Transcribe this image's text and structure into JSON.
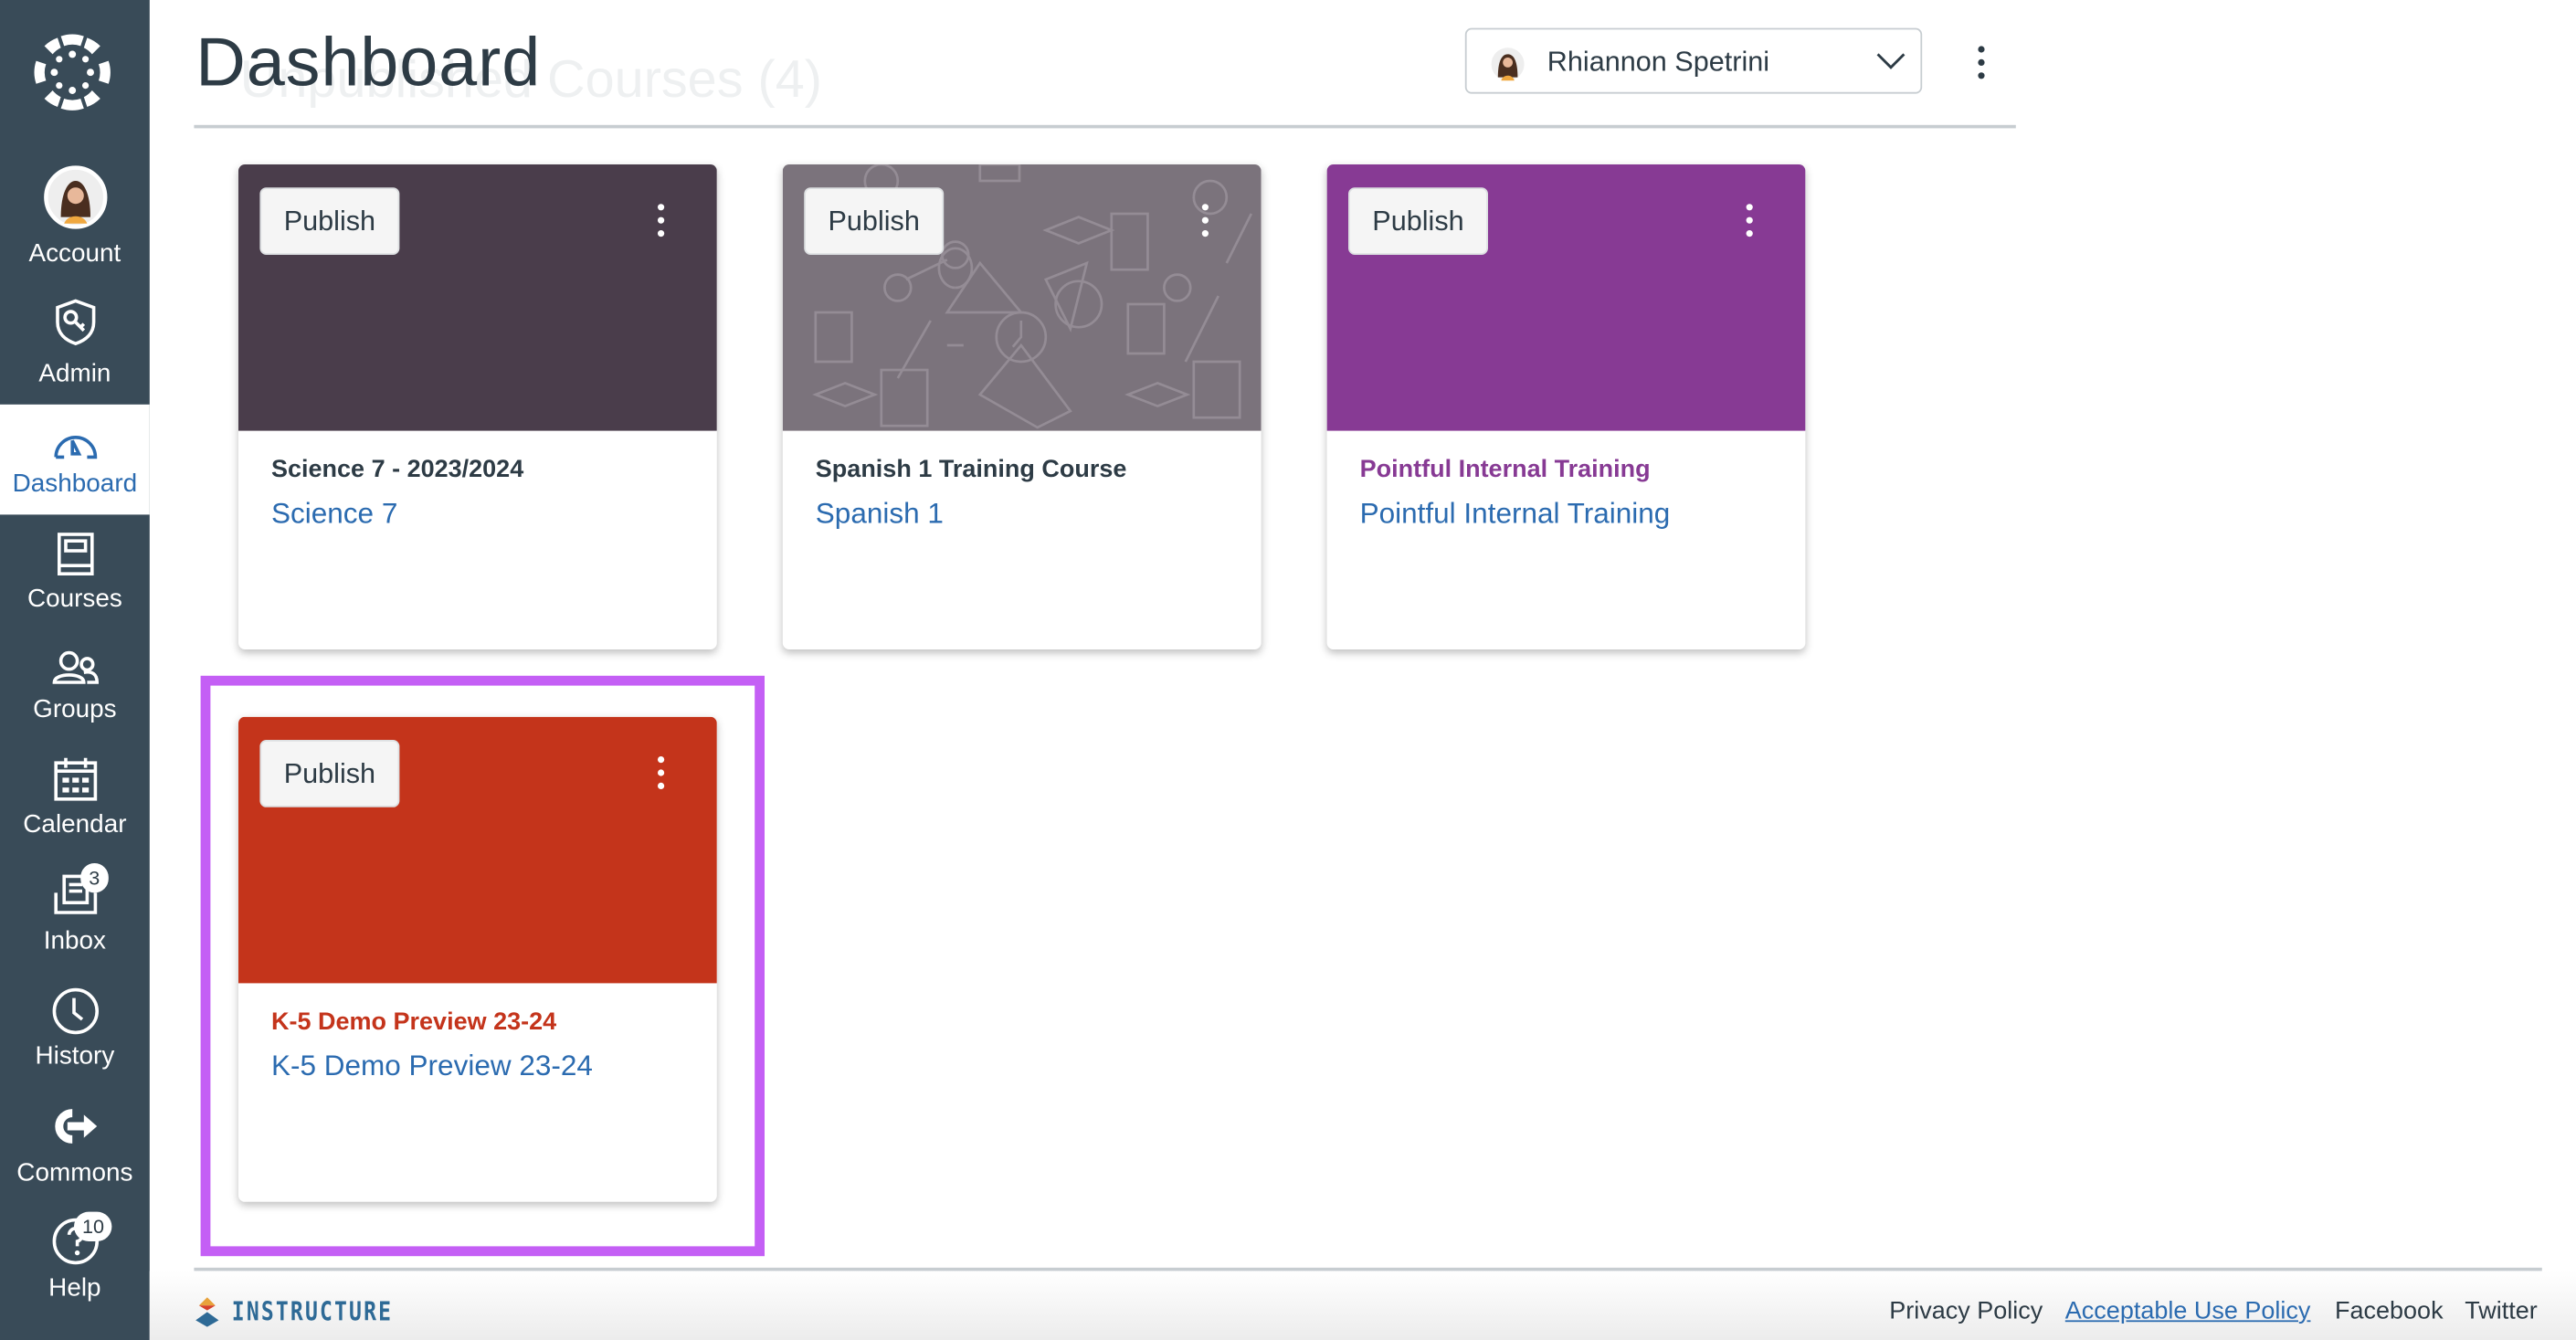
{
  "header": {
    "title": "Dashboard",
    "ghost_heading": "Unpublished Courses (4)",
    "user_name": "Rhiannon Spetrini"
  },
  "sidebar": {
    "items": [
      {
        "label": "Account",
        "icon": "avatar"
      },
      {
        "label": "Admin",
        "icon": "shield-key-icon"
      },
      {
        "label": "Dashboard",
        "icon": "speedometer-icon",
        "active": true
      },
      {
        "label": "Courses",
        "icon": "book-icon"
      },
      {
        "label": "Groups",
        "icon": "users-icon"
      },
      {
        "label": "Calendar",
        "icon": "calendar-icon"
      },
      {
        "label": "Inbox",
        "icon": "inbox-icon",
        "badge": "3"
      },
      {
        "label": "History",
        "icon": "clock-icon"
      },
      {
        "label": "Commons",
        "icon": "commons-icon"
      },
      {
        "label": "Help",
        "icon": "question-icon",
        "badge": "10"
      }
    ]
  },
  "cards": [
    {
      "publish": "Publish",
      "title": "Science 7 - 2023/2024",
      "link": "Science 7",
      "color": "#4A3D4B",
      "title_color": "#2D3B45"
    },
    {
      "publish": "Publish",
      "title": "Spanish 1 Training Course",
      "link": "Spanish 1",
      "color": "#7B737C",
      "title_color": "#2D3B45"
    },
    {
      "publish": "Publish",
      "title": "Pointful Internal Training",
      "link": "Pointful Internal Training",
      "color": "#873A94",
      "title_color": "#873A94"
    },
    {
      "publish": "Publish",
      "title": "K-5 Demo Preview 23-24",
      "link": "K-5 Demo Preview 23-24",
      "color": "#C4341B",
      "title_color": "#C4341B"
    }
  ],
  "highlight_color": "#C45FF5",
  "footer": {
    "brand": "INSTRUCTURE",
    "links": [
      "Privacy Policy",
      "Acceptable Use Policy",
      "Facebook",
      "Twitter"
    ]
  }
}
